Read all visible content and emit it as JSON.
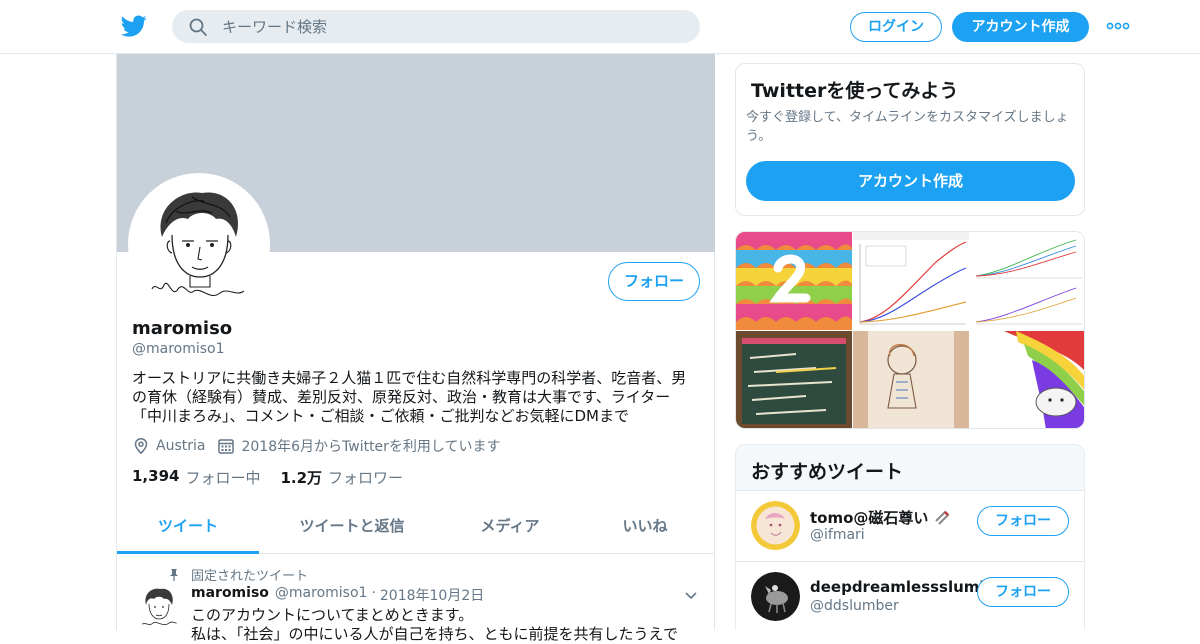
{
  "header": {
    "logo_icon": "twitter-bird-icon",
    "search_placeholder": "キーワード検索",
    "login_label": "ログイン",
    "signup_label": "アカウント作成",
    "more_icon": "more-dots-icon"
  },
  "profile": {
    "display_name": "maromiso",
    "handle": "@maromiso1",
    "follow_label": "フォロー",
    "bio_lines": [
      "オーストリアに共働き夫婦子２人猫１匹で住む自然科学専門の科学者、吃音者、男",
      "の育休（経験有）賛成、差別反対、原発反対、政治・教育は大事です、ライター",
      "「中川まろみ」、コメント・ご相談・ご依頼・ご批判などお気軽にDMまで"
    ],
    "location": "Austria",
    "joined": "2018年6月からTwitterを利用しています",
    "following_count": "1,394",
    "following_label": "フォロー中",
    "followers_count": "1.2万",
    "followers_label": "フォロワー"
  },
  "tabs": [
    "ツイート",
    "ツイートと返信",
    "メディア",
    "いいね"
  ],
  "pinned_tweet": {
    "pinned_label": "固定されたツイート",
    "name": "maromiso",
    "handle": "@maromiso1",
    "dot": "·",
    "date": "2018年10月2日",
    "text_line1": "このアカウントについてまとめときます。",
    "text_line2": "私は、「社会」の中にいる人が自己を持ち、ともに前提を共有したうえで"
  },
  "signup_card": {
    "title": "Twitterを使ってみよう",
    "desc_line1": "今すぐ登録して、タイムラインをカスタマイズしましょ",
    "desc_line2": "う。",
    "button_label": "アカウント作成"
  },
  "suggested": {
    "title": "おすすめツイート",
    "accounts": [
      {
        "name": "tomo@磁石尊い",
        "handle": "@ifmari",
        "follow_label": "フォロー"
      },
      {
        "name": "deepdreamlessslumber",
        "handle": "@ddslumber",
        "follow_label": "フォロー"
      }
    ]
  },
  "colors": {
    "brand": "#1da1f2",
    "banner": "#c8d1d9",
    "muted_text": "#657786",
    "border": "#e1e8ed"
  }
}
